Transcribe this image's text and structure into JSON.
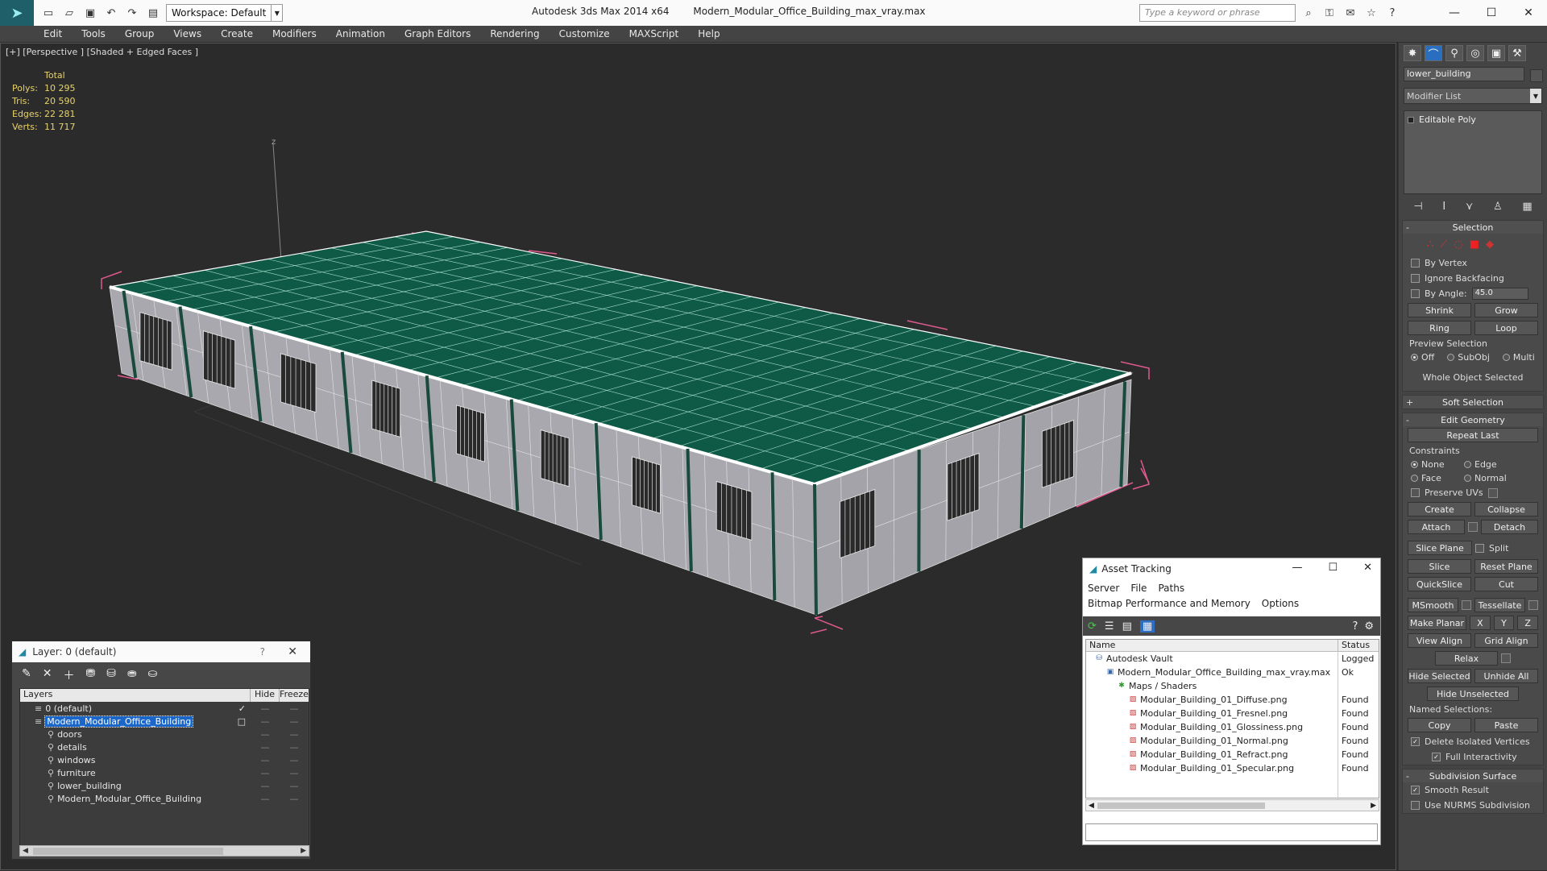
{
  "app": {
    "title": "Autodesk 3ds Max  2014 x64",
    "file": "Modern_Modular_Office_Building_max_vray.max",
    "workspace": "Workspace: Default",
    "search_placeholder": "Type a keyword or phrase"
  },
  "menu": [
    "Edit",
    "Tools",
    "Group",
    "Views",
    "Create",
    "Modifiers",
    "Animation",
    "Graph Editors",
    "Rendering",
    "Customize",
    "MAXScript",
    "Help"
  ],
  "viewport": {
    "label": "[+] [Perspective ] [Shaded + Edged Faces ]",
    "stats_header": "Total",
    "stats": [
      {
        "k": "Polys:",
        "v": "10 295"
      },
      {
        "k": "Tris:",
        "v": "20 590"
      },
      {
        "k": "Edges:",
        "v": "22 281"
      },
      {
        "k": "Verts:",
        "v": "11 717"
      }
    ],
    "axis_label": "z"
  },
  "command_panel": {
    "object_name": "lower_building",
    "modifier_list": "Modifier List",
    "stack_item": "Editable Poly",
    "selection": {
      "title": "Selection",
      "by_vertex": "By Vertex",
      "ignore_backfacing": "Ignore Backfacing",
      "by_angle": "By Angle:",
      "angle_value": "45.0",
      "shrink": "Shrink",
      "grow": "Grow",
      "ring": "Ring",
      "loop": "Loop",
      "preview_selection": "Preview Selection",
      "off": "Off",
      "subobj": "SubObj",
      "multi": "Multi",
      "whole_object": "Whole Object Selected"
    },
    "soft_selection": "Soft Selection",
    "edit_geometry": {
      "title": "Edit Geometry",
      "repeat_last": "Repeat Last",
      "constraints": "Constraints",
      "none": "None",
      "edge": "Edge",
      "face": "Face",
      "normal": "Normal",
      "preserve_uvs": "Preserve UVs",
      "create": "Create",
      "collapse": "Collapse",
      "attach": "Attach",
      "detach": "Detach",
      "slice_plane": "Slice Plane",
      "split": "Split",
      "slice": "Slice",
      "reset_plane": "Reset Plane",
      "quickslice": "QuickSlice",
      "cut": "Cut",
      "msmooth": "MSmooth",
      "tessellate": "Tessellate",
      "make_planar": "Make Planar",
      "x": "X",
      "y": "Y",
      "z": "Z",
      "view_align": "View Align",
      "grid_align": "Grid Align",
      "relax": "Relax",
      "hide_selected": "Hide Selected",
      "unhide_all": "Unhide All",
      "hide_unselected": "Hide Unselected",
      "named_selections": "Named Selections:",
      "copy": "Copy",
      "paste": "Paste",
      "delete_isolated": "Delete Isolated Vertices",
      "full_interactivity": "Full Interactivity"
    },
    "subdivision": {
      "title": "Subdivision Surface",
      "smooth_result": "Smooth Result",
      "use_nurms": "Use NURMS Subdivision"
    }
  },
  "layer_window": {
    "title": "Layer: 0 (default)",
    "help": "?",
    "col_layers": "Layers",
    "col_hide": "Hide",
    "col_freeze": "Freeze",
    "rows": [
      {
        "name": "0 (default)",
        "indent": 1,
        "checked": true
      },
      {
        "name": "Modern_Modular_Office_Building",
        "indent": 1,
        "selected": true
      },
      {
        "name": "doors",
        "indent": 2
      },
      {
        "name": "details",
        "indent": 2
      },
      {
        "name": "windows",
        "indent": 2
      },
      {
        "name": "furniture",
        "indent": 2
      },
      {
        "name": "lower_building",
        "indent": 2
      },
      {
        "name": "Modern_Modular_Office_Building",
        "indent": 2
      }
    ]
  },
  "asset_window": {
    "title": "Asset Tracking",
    "menu": [
      "Server",
      "File",
      "Paths",
      "Bitmap Performance and Memory",
      "Options"
    ],
    "col_name": "Name",
    "col_status": "Status",
    "rows": [
      {
        "name": "Autodesk Vault",
        "status": "Logged",
        "indent": 1
      },
      {
        "name": "Modern_Modular_Office_Building_max_vray.max",
        "status": "Ok",
        "indent": 2
      },
      {
        "name": "Maps / Shaders",
        "status": "",
        "indent": 3
      },
      {
        "name": "Modular_Building_01_Diffuse.png",
        "status": "Found",
        "indent": 4
      },
      {
        "name": "Modular_Building_01_Fresnel.png",
        "status": "Found",
        "indent": 4
      },
      {
        "name": "Modular_Building_01_Glossiness.png",
        "status": "Found",
        "indent": 4
      },
      {
        "name": "Modular_Building_01_Normal.png",
        "status": "Found",
        "indent": 4
      },
      {
        "name": "Modular_Building_01_Refract.png",
        "status": "Found",
        "indent": 4
      },
      {
        "name": "Modular_Building_01_Specular.png",
        "status": "Found",
        "indent": 4
      }
    ]
  },
  "colors": {
    "roof": "#0f5a46",
    "wall": "#a7a7ad",
    "bbox": "#e05a8f",
    "stats": "#e8d36a"
  }
}
